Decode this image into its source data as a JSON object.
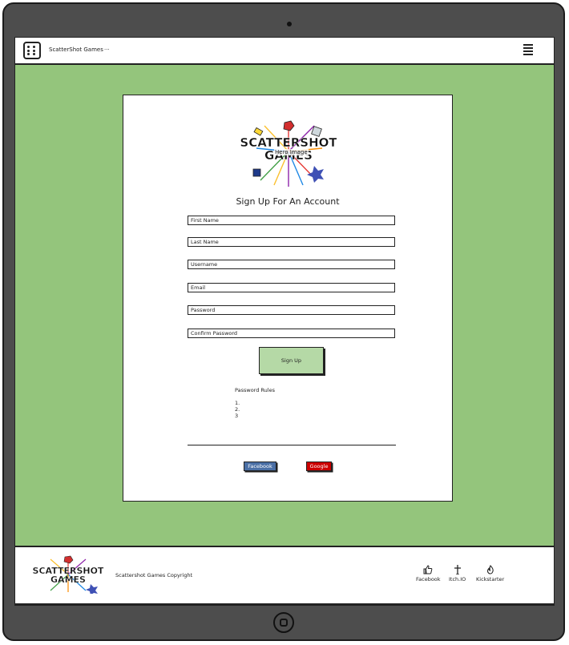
{
  "header": {
    "brand": "ScatterShot Games",
    "dots": "..."
  },
  "hero": {
    "label": "Hero Image",
    "logo_text": [
      "SCATTERSHOT",
      "GAMES"
    ]
  },
  "form": {
    "title": "Sign Up For An Account",
    "fields": [
      {
        "placeholder": "First Name"
      },
      {
        "placeholder": "Last Name"
      },
      {
        "placeholder": "Username"
      },
      {
        "placeholder": "Email"
      },
      {
        "placeholder": "Password"
      },
      {
        "placeholder": "Confirm Password"
      }
    ],
    "submit_label": "Sign Up",
    "rules_title": "Password Rules",
    "rules": [
      "1.",
      "2.",
      "3"
    ],
    "social": {
      "facebook": "Facebook",
      "google": "Google"
    }
  },
  "footer": {
    "logo_text": [
      "SCATTERSHOT",
      "GAMES"
    ],
    "copyright": "Scattershot Games Copyright",
    "links": [
      {
        "label": "Facebook",
        "icon": "thumbs-up-icon"
      },
      {
        "label": "Itch.IO",
        "icon": "itchio-icon"
      },
      {
        "label": "Kickstarter",
        "icon": "flame-icon"
      }
    ]
  },
  "colors": {
    "background": "#94c57c",
    "button": "#b5d9a6",
    "facebook": "#4a6fa5",
    "google": "#cc0000",
    "frame": "#4d4d4d"
  }
}
